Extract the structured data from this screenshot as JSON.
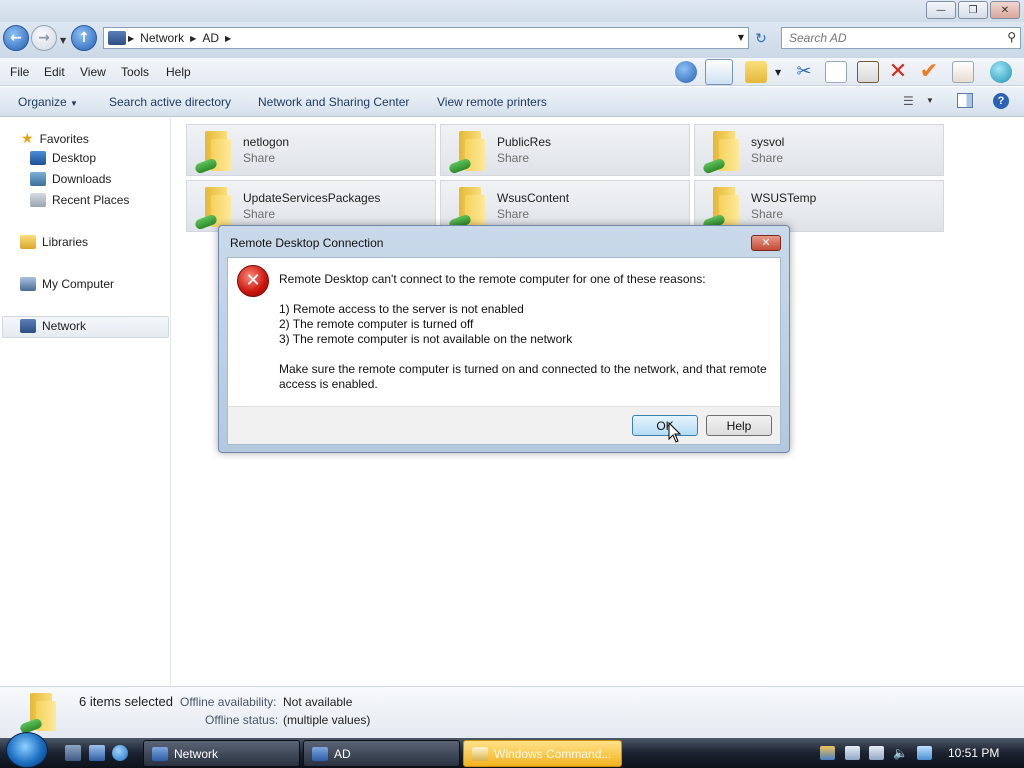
{
  "address": {
    "breadcrumbs": [
      "Network",
      "AD"
    ],
    "search_placeholder": "Search AD"
  },
  "menu": [
    "File",
    "Edit",
    "View",
    "Tools",
    "Help"
  ],
  "command_bar": {
    "organize": "Organize",
    "search_ad": "Search active directory",
    "network_center": "Network and Sharing Center",
    "remote_printers": "View remote printers"
  },
  "nav": {
    "favorites": "Favorites",
    "desktop": "Desktop",
    "downloads": "Downloads",
    "recent": "Recent Places",
    "libraries": "Libraries",
    "computer": "My Computer",
    "network": "Network"
  },
  "shares": [
    {
      "name": "netlogon",
      "type": "Share"
    },
    {
      "name": "PublicRes",
      "type": "Share"
    },
    {
      "name": "sysvol",
      "type": "Share"
    },
    {
      "name": "UpdateServicesPackages",
      "type": "Share"
    },
    {
      "name": "WsusContent",
      "type": "Share"
    },
    {
      "name": "WSUSTemp",
      "type": "Share"
    }
  ],
  "details": {
    "count": "6 items selected",
    "offline_label": "Offline availability:",
    "offline_value": "Not available",
    "status_label": "Offline status:",
    "status_value": "(multiple values)"
  },
  "dialog": {
    "title": "Remote Desktop Connection",
    "intro": "Remote Desktop can't connect to the remote computer for one of these reasons:",
    "reasons": [
      "1) Remote access to the server is not enabled",
      "2) The remote computer is turned off",
      "3) The remote computer is not available on the network"
    ],
    "advice_line1": "Make sure the remote computer is turned on and connected to the network, and that remote",
    "advice_line2": "access is enabled.",
    "ok": "OK",
    "help": "Help"
  },
  "taskbar": {
    "tasks": [
      "Network",
      "AD",
      "Windows Command..."
    ],
    "clock": "10:51 PM"
  },
  "colors": {
    "accent": "#2360b5",
    "error": "#c8140c",
    "taskbar": "#1c2230"
  }
}
